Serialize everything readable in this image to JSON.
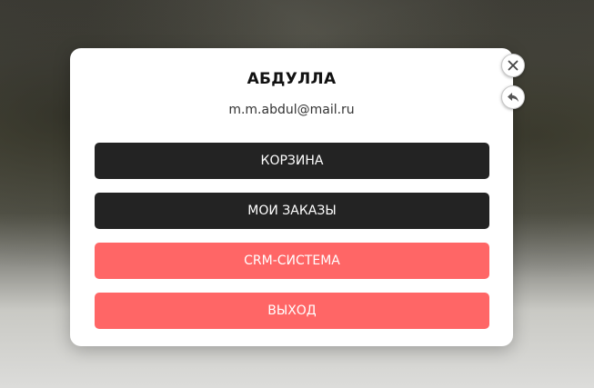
{
  "profile": {
    "name": "АБДУЛЛА",
    "email": "m.m.abdul@mail.ru"
  },
  "menu": {
    "cart_label": "КОРЗИНА",
    "orders_label": "МОИ ЗАКАЗЫ",
    "crm_label": "CRM-СИСТЕМА",
    "logout_label": "ВЫХОД"
  },
  "controls": {
    "close_icon": "close-icon",
    "back_icon": "reply-arrow-icon"
  },
  "colors": {
    "dark_button": "#232323",
    "accent_button": "#ff6666",
    "modal_background": "#ffffff"
  }
}
